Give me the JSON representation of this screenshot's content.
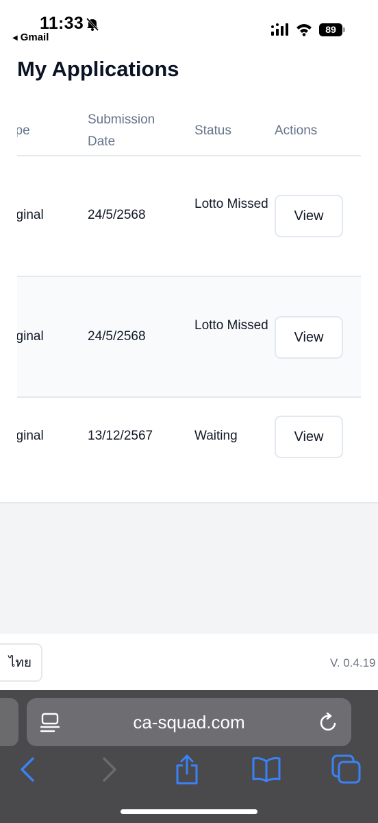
{
  "status_bar": {
    "time": "11:33",
    "back_app": "Gmail",
    "battery": "89"
  },
  "page": {
    "title": "My Applications"
  },
  "table": {
    "headers": {
      "type": "ype",
      "submission_date": "Submission Date",
      "status": "Status",
      "actions": "Actions"
    },
    "rows": [
      {
        "type": "riginal",
        "date": "24/5/2568",
        "status": "Lotto Missed",
        "action": "View"
      },
      {
        "type": "riginal",
        "date": "24/5/2568",
        "status": "Lotto Missed",
        "action": "View"
      },
      {
        "type": "riginal",
        "date": "13/12/2567",
        "status": "Waiting",
        "action": "View"
      }
    ]
  },
  "footer": {
    "language_button": "ไทย",
    "version": "V. 0.4.19"
  },
  "browser": {
    "url": "ca-squad.com",
    "toolbar_icons": [
      "back-icon",
      "forward-icon",
      "share-icon",
      "bookmarks-icon",
      "tabs-icon"
    ]
  },
  "colors": {
    "accent": "#3b82f6",
    "header_text": "#64748b",
    "safari_bar": "#4a4a4c"
  }
}
